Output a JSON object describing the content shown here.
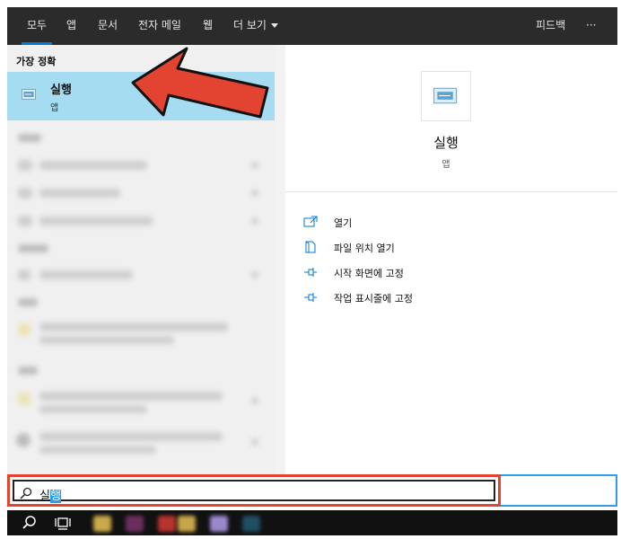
{
  "nav": {
    "tabs": [
      {
        "label": "모두"
      },
      {
        "label": "앱"
      },
      {
        "label": "문서"
      },
      {
        "label": "전자 메일"
      },
      {
        "label": "웹"
      },
      {
        "label": "더 보기"
      }
    ],
    "feedback": "피드백",
    "more": "···"
  },
  "left": {
    "section_title": "가장 정확",
    "best": {
      "title": "실행",
      "subtitle": "앱"
    }
  },
  "right": {
    "title": "실행",
    "subtitle": "앱",
    "actions": [
      {
        "label": "열기",
        "icon": "open-icon"
      },
      {
        "label": "파일 위치 열기",
        "icon": "file-location-icon"
      },
      {
        "label": "시작 화면에 고정",
        "icon": "pin-icon"
      },
      {
        "label": "작업 표시줄에 고정",
        "icon": "pin-icon"
      }
    ]
  },
  "search": {
    "typed_prefix": "실",
    "typed_selected": "행"
  },
  "colors": {
    "accent": "#0078d7",
    "highlight": "#a6dcf2",
    "annotation_red": "#e24431"
  }
}
